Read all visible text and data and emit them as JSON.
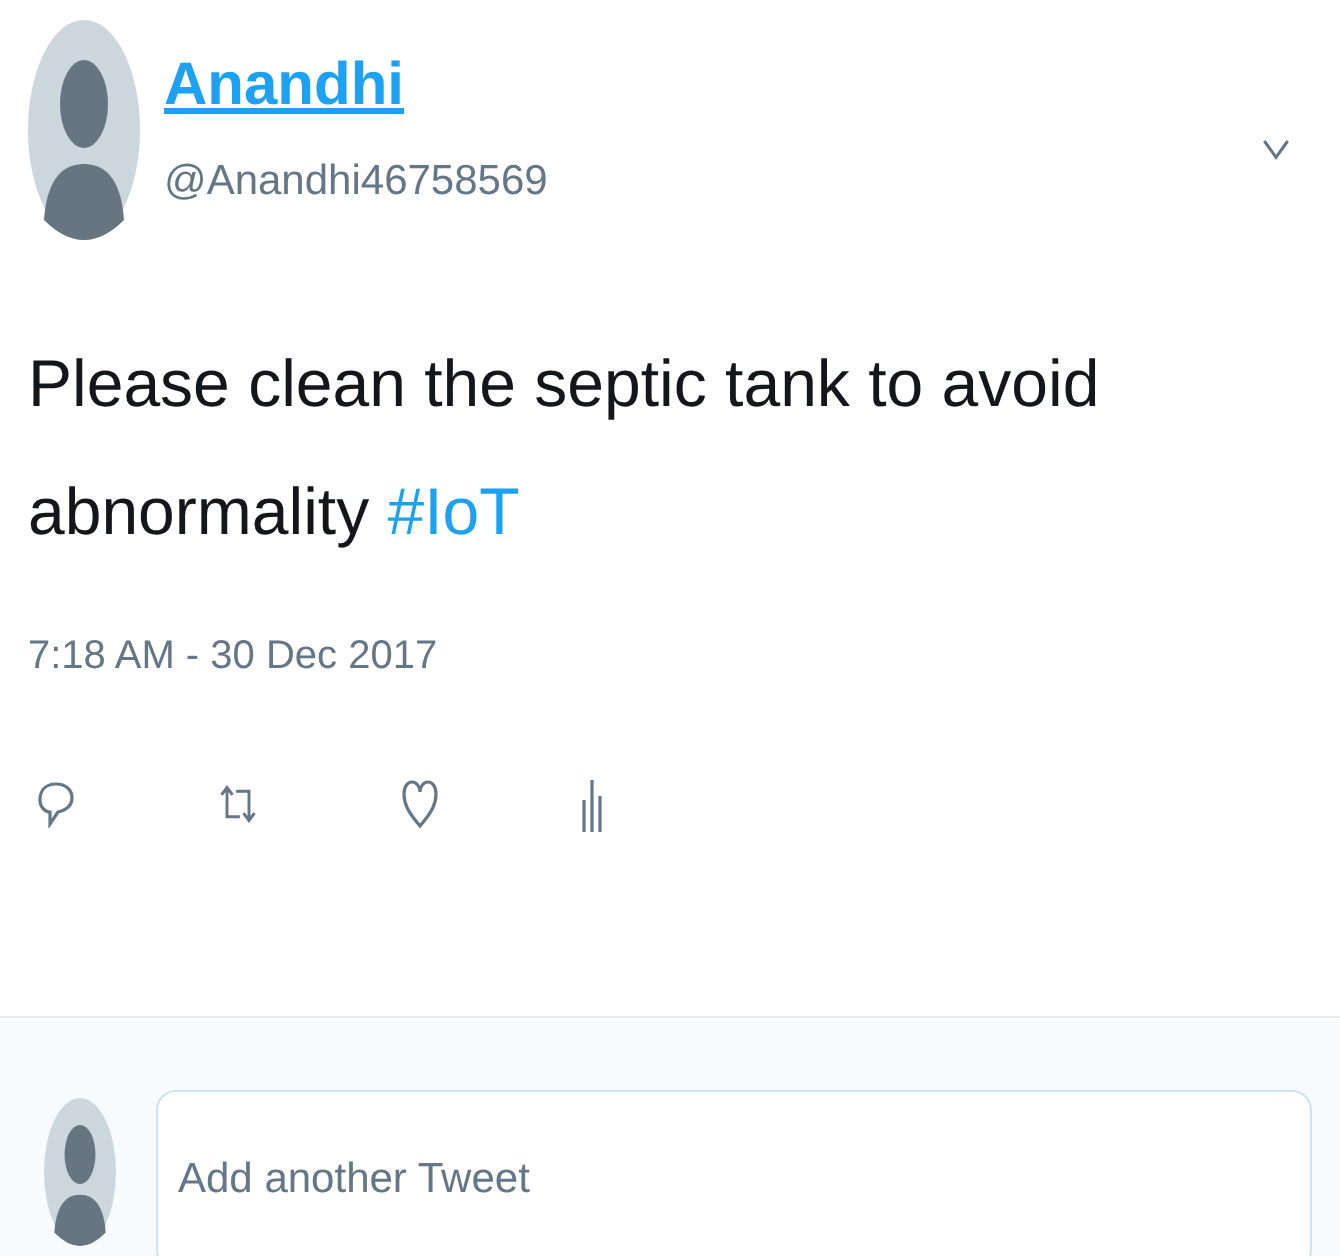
{
  "author": {
    "name": "Anandhi",
    "handle": "@Anandhi46758569"
  },
  "tweet": {
    "text": "Please clean the septic tank to avoid abnormality",
    "hashtag": "#IoT",
    "timestamp": "7:18 AM - 30 Dec 2017"
  },
  "reply": {
    "placeholder": "Add another Tweet"
  }
}
